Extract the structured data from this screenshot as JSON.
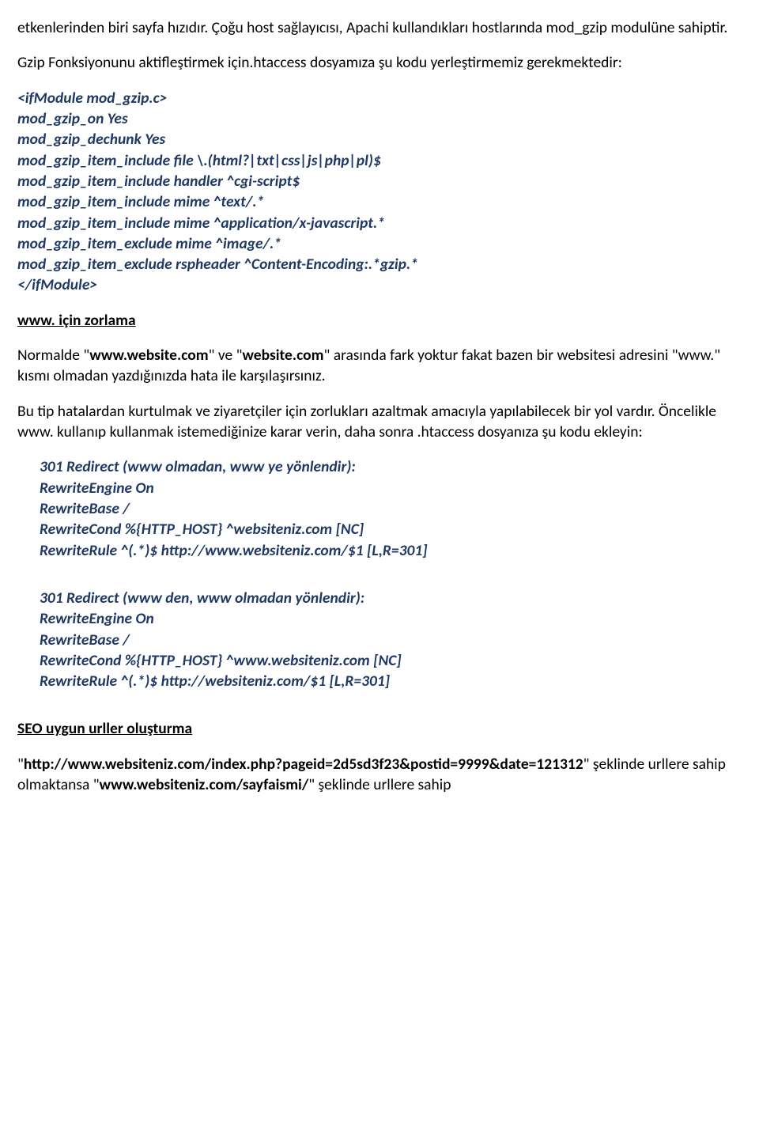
{
  "intro": {
    "p1_a": "etkenlerinden biri sayfa hızıdır. Çoğu host sağlayıcısı, Apachi kullandıkları hostlarında mod_gzip modulüne sahiptir.",
    "p2_a": "Gzip Fonksiyonunu aktifleştirmek için.htaccess dosyamıza şu kodu yerleştirmemiz gerekmektedir:"
  },
  "gzip": {
    "l1": "<ifModule mod_gzip.c>",
    "l2": "mod_gzip_on Yes",
    "l3": "mod_gzip_dechunk Yes",
    "l4": "mod_gzip_item_include file \\.(html?|txt|css|js|php|pl)$",
    "l5": "mod_gzip_item_include handler ^cgi-script$",
    "l6": "mod_gzip_item_include mime ^text/.*",
    "l7": "mod_gzip_item_include mime ^application/x-javascript.*",
    "l8": "mod_gzip_item_exclude mime ^image/.*",
    "l9": "mod_gzip_item_exclude rspheader ^Content-Encoding:.*gzip.*",
    "l10": "</ifModule>"
  },
  "www": {
    "heading": "www. için zorlama",
    "p1_pre": "Normalde \"",
    "p1_b1": "www.website.com",
    "p1_mid1": "\" ve \"",
    "p1_b2": "website.com",
    "p1_post": "\" arasında fark yoktur fakat bazen bir websitesi adresini \"www.\" kısmı olmadan yazdığınızda hata ile karşılaşırsınız.",
    "p2": "Bu tip hatalardan kurtulmak ve ziyaretçiler için zorlukları azaltmak amacıyla yapılabilecek bir yol vardır. Öncelikle www. kullanıp kullanmak istemediğinize karar verin, daha sonra .htaccess dosyanıza şu kodu ekleyin:"
  },
  "redir1": {
    "l1": "301 Redirect (www olmadan, www ye yönlendir):",
    "l2": "RewriteEngine On",
    "l3": "RewriteBase /",
    "l4": "RewriteCond %{HTTP_HOST} ^websiteniz.com [NC]",
    "l5": "RewriteRule ^(.*)$ http://www.websiteniz.com/$1 [L,R=301]"
  },
  "redir2": {
    "l1": "301 Redirect (www den, www olmadan yönlendir):",
    "l2": "RewriteEngine On",
    "l3": "RewriteBase /",
    "l4": "RewriteCond %{HTTP_HOST} ^www.websiteniz.com [NC]",
    "l5": "RewriteRule ^(.*)$ http://websiteniz.com/$1 [L,R=301]"
  },
  "seo": {
    "heading": "SEO uygun urller oluşturma",
    "p_pre": "\"",
    "p_b1": "http://www.websiteniz.com/index.php?pageid=2d5sd3f23&postid=9999&date=121312",
    "p_mid": "\" şeklinde urllere sahip olmaktansa \"",
    "p_b2": "www.websiteniz.com/sayfaismi/",
    "p_post": "\" şeklinde urllere sahip"
  }
}
